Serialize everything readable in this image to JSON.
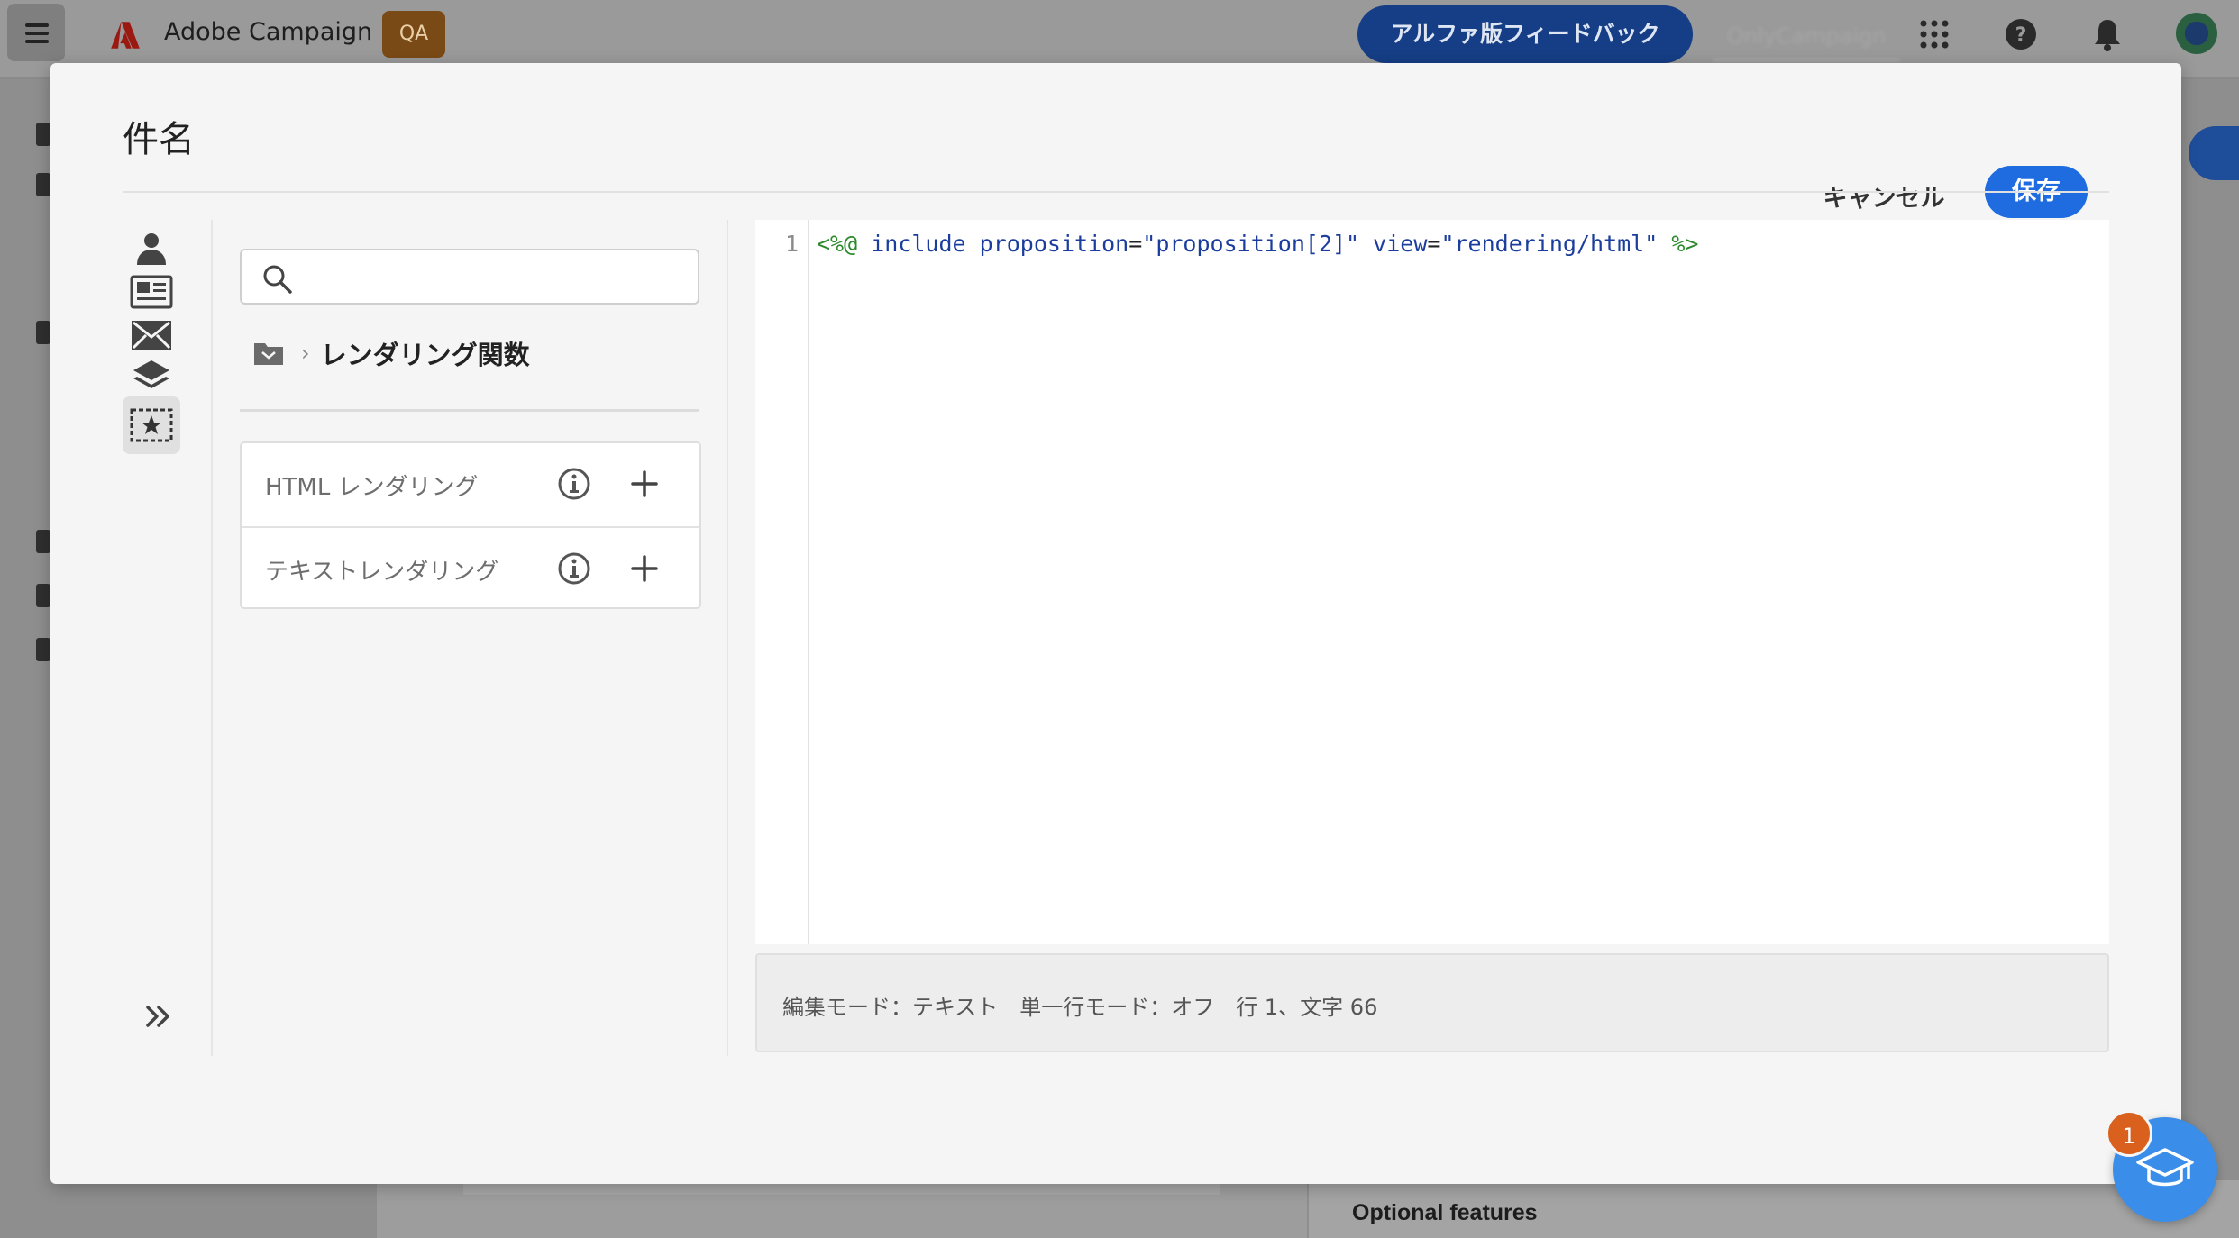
{
  "app": {
    "name": "Adobe Campaign",
    "env_badge": "QA",
    "feedback_button": "アルファ版フィードバック",
    "org_switcher": "OnlyCampaign"
  },
  "background": {
    "optional_features": "Optional features"
  },
  "modal": {
    "title": "件名",
    "cancel_label": "キャンセル",
    "save_label": "保存",
    "rail_items": [
      "profile-icon",
      "content-block-icon",
      "email-icon",
      "layers-icon",
      "personalization-star-icon"
    ],
    "search": {
      "placeholder": "",
      "value": ""
    },
    "breadcrumb": {
      "current": "レンダリング関数"
    },
    "functions": [
      {
        "label": "HTML レンダリング"
      },
      {
        "label": "テキストレンダリング"
      }
    ],
    "editor": {
      "line_number": "1",
      "code_tokens": {
        "open": "<%@",
        "directive": "include",
        "attr1_name": "proposition",
        "attr1_value": "\"proposition[2]\"",
        "attr2_name": "view",
        "attr2_value": "\"rendering/html\"",
        "close": "%>"
      }
    },
    "status": "編集モード：テキスト　単一行モード：オフ　行 1、文字 66"
  },
  "help": {
    "badge_count": "1"
  },
  "colors": {
    "primary": "#1f6ce0",
    "badge": "#d9601d",
    "fab": "#3a8de8"
  }
}
